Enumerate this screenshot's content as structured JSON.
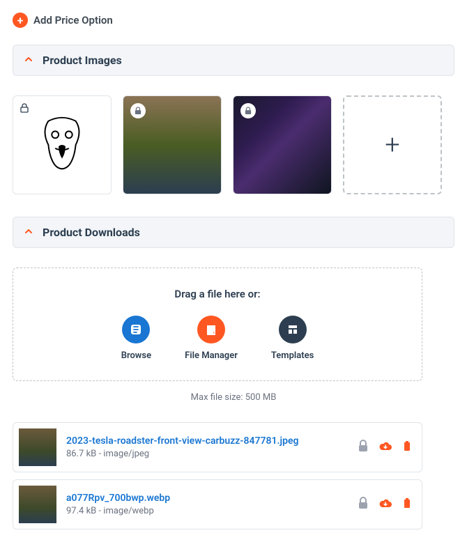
{
  "add_price_label": "Add Price Option",
  "sections": {
    "images": "Product Images",
    "downloads": "Product Downloads"
  },
  "dropzone": {
    "prompt": "Drag a file here or:",
    "browse": "Browse",
    "file_manager": "File Manager",
    "templates": "Templates"
  },
  "max_file": "Max file size: 500 MB",
  "files": [
    {
      "name": "2023-tesla-roadster-front-view-carbuzz-847781.jpeg",
      "meta": "86.7 kB - image/jpeg"
    },
    {
      "name": "a077Rpv_700bwp.webp",
      "meta": "97.4 kB - image/webp"
    }
  ]
}
